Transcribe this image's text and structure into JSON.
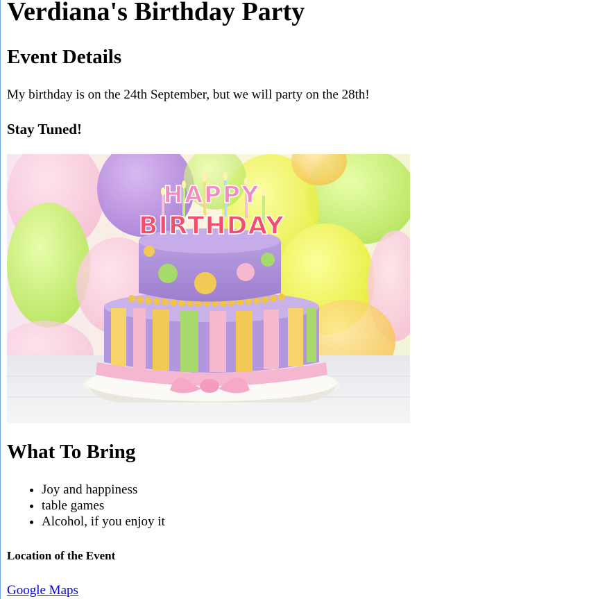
{
  "page": {
    "title": "Verdiana's Birthday Party",
    "event_heading": "Event Details",
    "event_text": "My birthday is on the 24th September, but we will party on the 28th!",
    "stay_tuned": "Stay Tuned!",
    "image_text": {
      "line1": "HAPPY",
      "line2": "BIRTHDAY"
    },
    "bring_heading": "What To Bring",
    "bring_items": [
      "Joy and happiness",
      "table games",
      "Alcohol, if you enjoy it"
    ],
    "location_heading": "Location of the Event",
    "maps_link": "Google Maps"
  },
  "colors": {
    "link": "#0000ee",
    "left_rule": "#6aa6d8"
  }
}
